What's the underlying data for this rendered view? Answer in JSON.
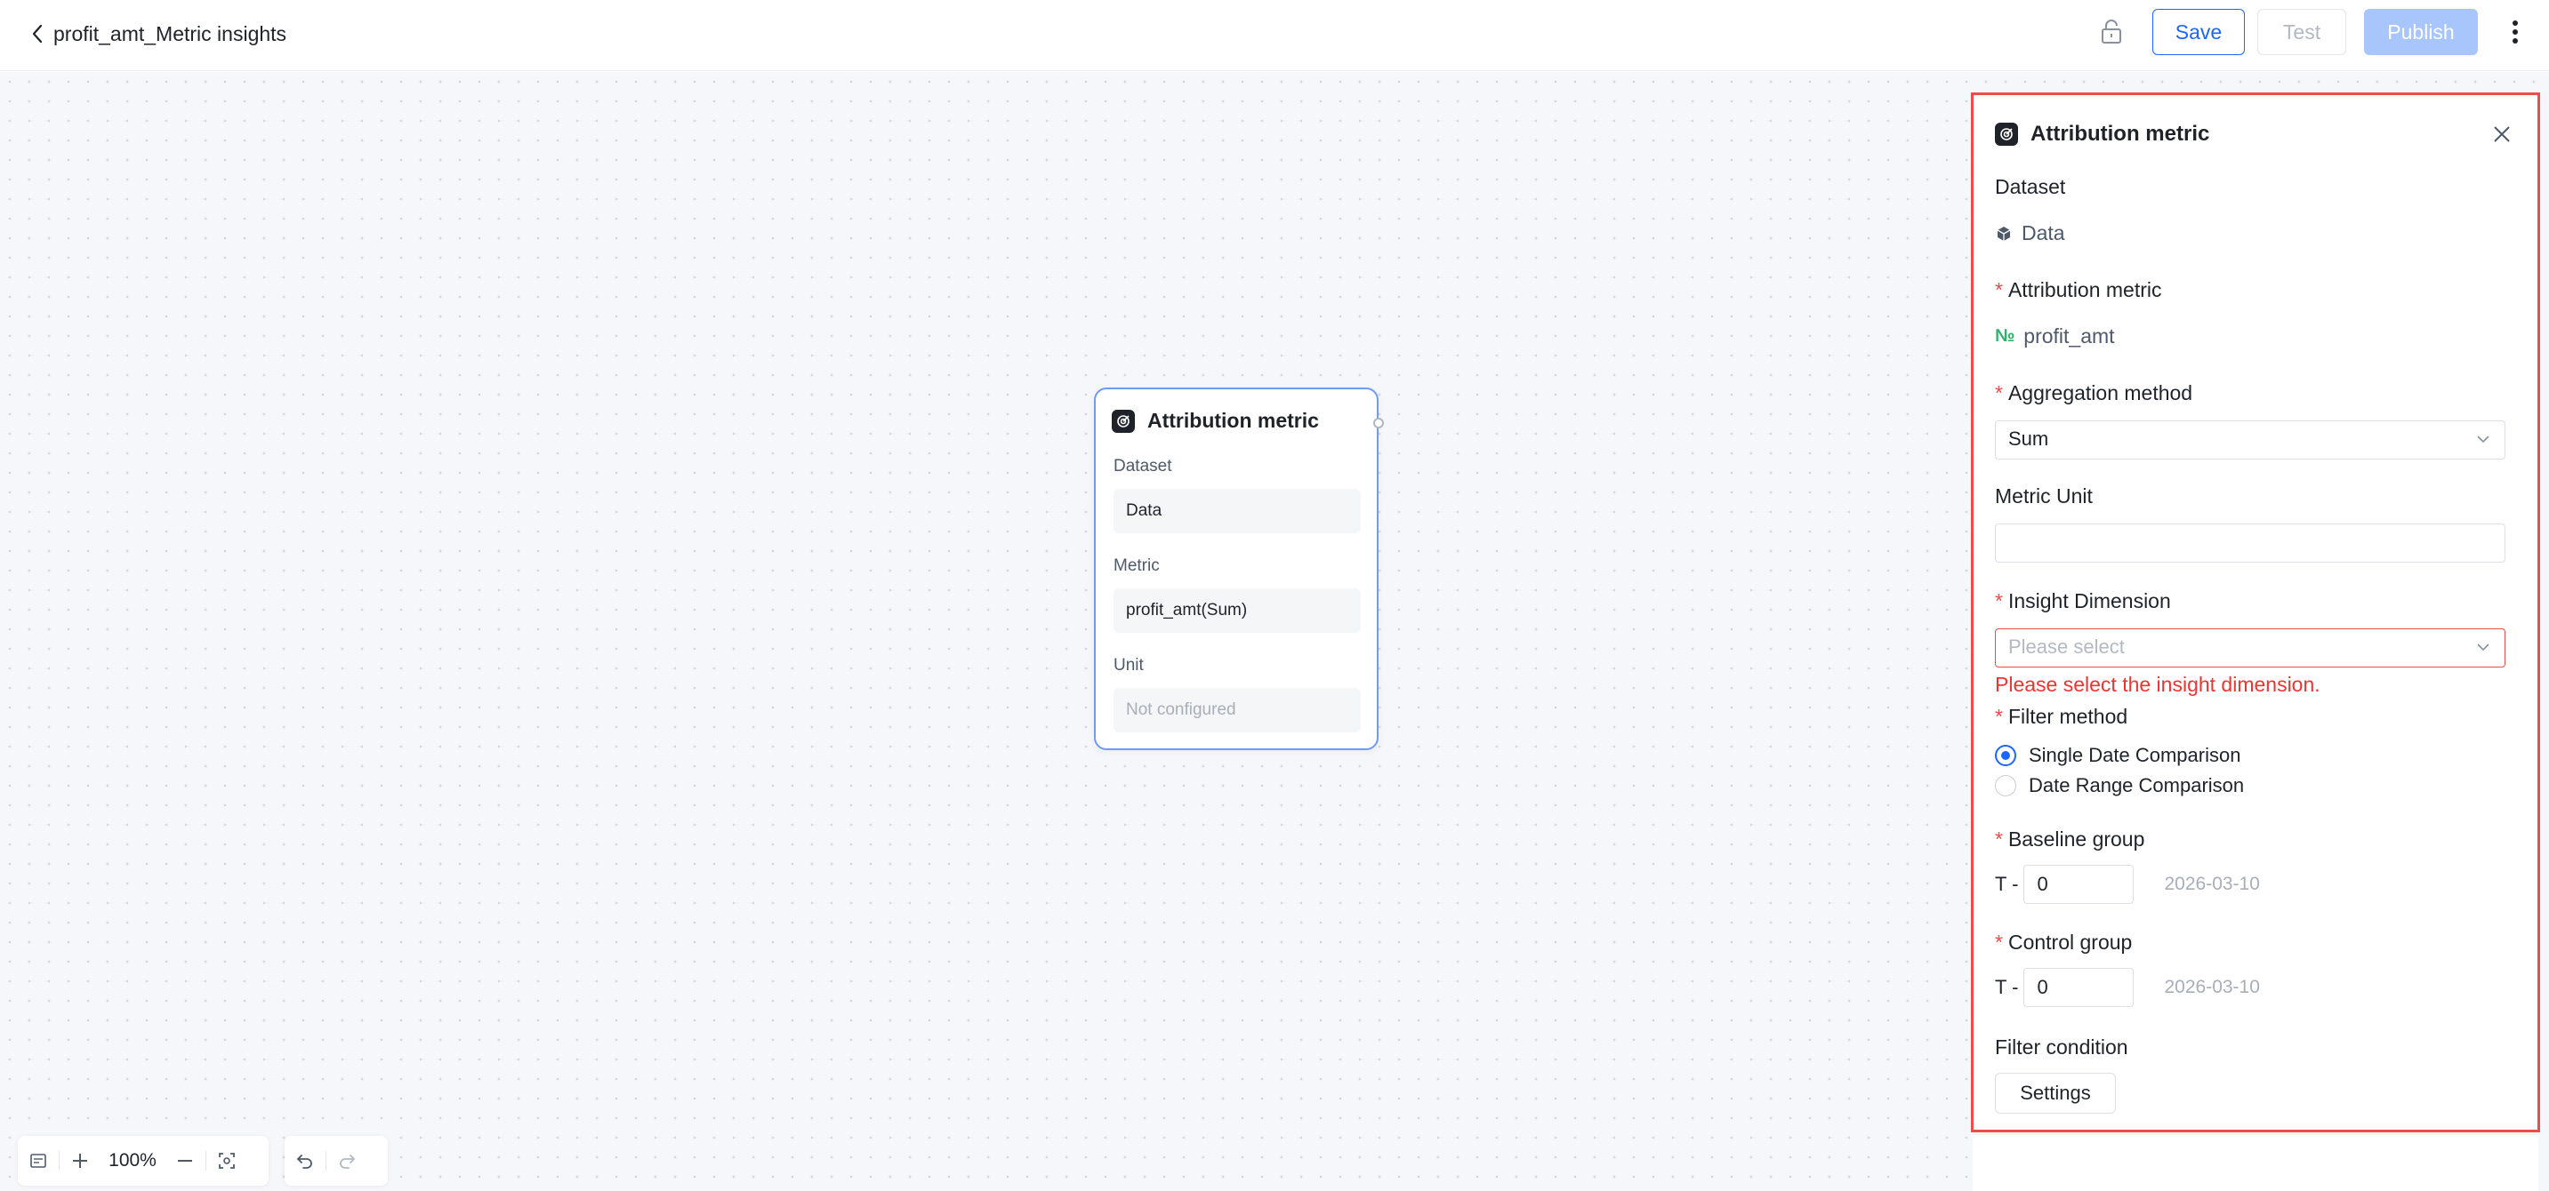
{
  "header": {
    "title": "profit_amt_Metric insights",
    "save_label": "Save",
    "test_label": "Test",
    "publish_label": "Publish"
  },
  "node": {
    "title": "Attribution metric",
    "dataset_label": "Dataset",
    "dataset_value": "Data",
    "metric_label": "Metric",
    "metric_value": "profit_amt(Sum)",
    "unit_label": "Unit",
    "unit_value": "Not configured"
  },
  "toolbar": {
    "zoom": "100%"
  },
  "panel": {
    "title": "Attribution metric",
    "dataset_label": "Dataset",
    "dataset_value": "Data",
    "metric_label": "Attribution metric",
    "metric_value": "profit_amt",
    "metric_type_glyph": "№",
    "aggregation_label": "Aggregation method",
    "aggregation_value": "Sum",
    "unit_label": "Metric Unit",
    "unit_value": "",
    "dimension_label": "Insight Dimension",
    "dimension_placeholder": "Please select",
    "dimension_error": "Please select the insight dimension.",
    "filter_method_label": "Filter method",
    "filter_options": [
      "Single Date Comparison",
      "Date Range Comparison"
    ],
    "filter_selected": "Single Date Comparison",
    "baseline_label": "Baseline group",
    "baseline_prefix": "T -",
    "baseline_value": "0",
    "baseline_date": "2026-03-10",
    "control_label": "Control group",
    "control_prefix": "T -",
    "control_value": "0",
    "control_date": "2026-03-10",
    "filter_condition_label": "Filter condition",
    "settings_label": "Settings",
    "required_mark": "*"
  },
  "colors": {
    "primary": "#1a66ff",
    "publish_disabled": "#a8c6fb",
    "error": "#ee4b4b",
    "node_border": "#6d9bf5",
    "metric_glyph": "#2fb36b"
  }
}
